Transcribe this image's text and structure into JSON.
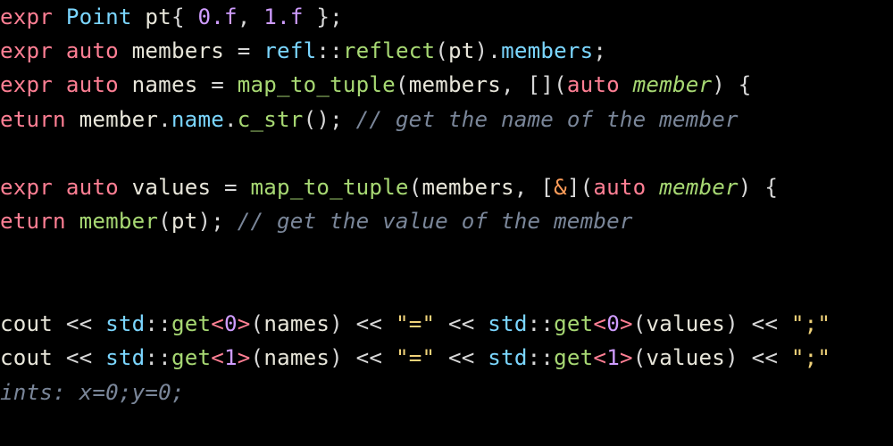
{
  "code": {
    "line1": {
      "kw": "expr",
      "type": "Point",
      "var": "pt",
      "n0": "0",
      "f0": ".f",
      "n1": "1",
      "f1": ".f"
    },
    "line2": {
      "kw": "expr",
      "auto": "auto",
      "var": "members",
      "refl": "refl",
      "reflect": "reflect",
      "pt": "pt",
      "members": "members"
    },
    "line3": {
      "kw": "expr",
      "auto": "auto",
      "var": "names",
      "fn": "map_to_tuple",
      "members": "members",
      "auto2": "auto",
      "param": "member"
    },
    "line4": {
      "kw": "eturn",
      "member": "member",
      "name": "name",
      "cstr": "c_str",
      "cmt": "// get the name of the member"
    },
    "line5": {
      "kw": "expr",
      "auto": "auto",
      "var": "values",
      "fn": "map_to_tuple",
      "members": "members",
      "amp": "&",
      "auto2": "auto",
      "param": "member"
    },
    "line6": {
      "kw": "eturn",
      "fn": "member",
      "pt": "pt",
      "cmt": "// get the value of the member"
    },
    "line7": {
      "cout": "cout",
      "std": "std",
      "get": "get",
      "idx": "0",
      "names": "names",
      "eq": "\"=\"",
      "values": "values",
      "semi": "\";\""
    },
    "line8": {
      "cout": "cout",
      "std": "std",
      "get": "get",
      "idx": "1",
      "names": "names",
      "eq": "\"=\"",
      "values": "values",
      "semi": "\";\""
    },
    "line9": {
      "cmt": "ints: x=0;y=0;"
    }
  }
}
